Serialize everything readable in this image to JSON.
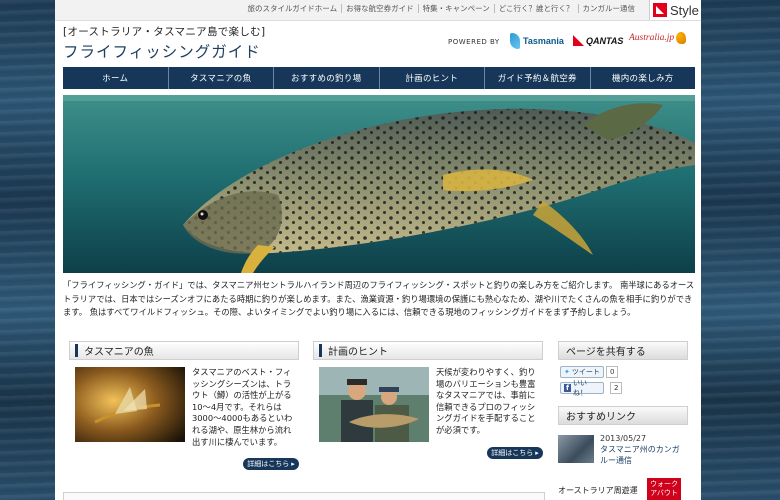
{
  "top_links": [
    "旅のスタイルガイドホーム",
    "お得な航空券ガイド",
    "特集・キャンペーン",
    "どこ行く？誰と行く？",
    "カンガルー通信"
  ],
  "style_badge": "Style",
  "header": {
    "subtitle": "[オーストラリア・タスマニア島で楽しむ]",
    "title": "フライフィッシングガイド"
  },
  "powered_by": "POWERED BY",
  "sponsors": {
    "tasmania": "Tasmania",
    "qantas": "QANTAS",
    "australia": "Australia.jp"
  },
  "nav": [
    "ホーム",
    "タスマニアの魚",
    "おすすめの釣り場",
    "計画のヒント",
    "ガイド予約＆航空券",
    "機内の楽しみ方"
  ],
  "intro": "「フライフィッシング・ガイド」では、タスマニア州セントラルハイランド周辺のフライフィッシング・スポットと釣りの楽しみ方をご紹介します。 南半球にあるオーストラリアでは、日本ではシーズンオフにあたる時期に釣りが楽しめます。また、漁業資源・釣り場環境の保護にも熱心なため、湖や川でたくさんの魚を相手に釣りができます。 魚はすべてワイルドフィッシュ。その際、よいタイミングでよい釣り場に入るには、信頼できる現地のフィッシングガイドをまず予約しましょう。",
  "sections": [
    {
      "title": "タスマニアの魚",
      "body": "タスマニアのベスト・フィッシングシーズンは、トラウト（鱒）の活性が上がる10～4月です。それらは3000～4000もあるといわれる湖や、原生林から流れ出す川に棲んでいます。",
      "more": "詳細はこちら"
    },
    {
      "title": "計画のヒント",
      "body": "天候が変わりやすく、釣り場のバリエーションも豊富なタスマニアでは、事前に信頼できるプロのフィッシングガイドを手配することが必須です。",
      "more": "詳細はこちら"
    }
  ],
  "sidebar": {
    "share_title": "ページを共有する",
    "tweet": "ツイート",
    "tweet_count": "0",
    "like": "いいね！",
    "like_count": "2",
    "rec_title": "おすすめリンク",
    "rec_date": "2013/05/27",
    "rec_link": "タスマニア州のカンガルー通信",
    "rec_foot": "オーストラリア周遊運",
    "walk": "ウォーク アバウト"
  },
  "colors": {
    "navy": "#17375a",
    "red": "#d0021b",
    "background_water": "#2c5676"
  }
}
